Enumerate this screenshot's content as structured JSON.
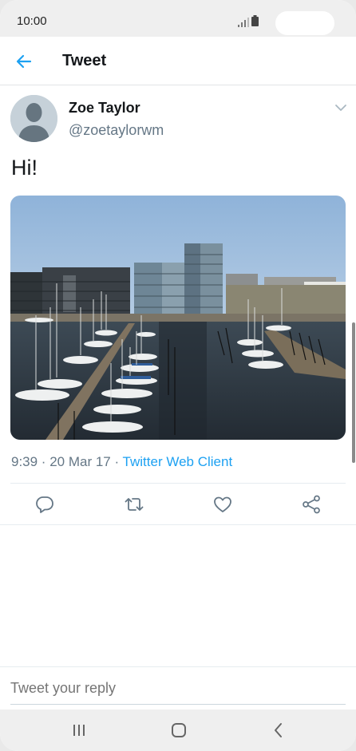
{
  "status_bar": {
    "time": "10:00"
  },
  "app_bar": {
    "title": "Tweet",
    "back_icon": "arrow-left-icon"
  },
  "tweet": {
    "display_name": "Zoe Taylor",
    "handle": "@zoetaylorwm",
    "text": "Hi!",
    "timestamp": "9:39 · 20 Mar 17 · ",
    "source": "Twitter Web Client",
    "photo_icon": "harbor-photo"
  },
  "actions": [
    {
      "name": "reply-icon"
    },
    {
      "name": "retweet-icon"
    },
    {
      "name": "like-icon"
    },
    {
      "name": "share-icon"
    }
  ],
  "reply": {
    "placeholder": "Tweet your reply"
  },
  "colors": {
    "accent": "#1da1f2",
    "muted": "#657786",
    "text": "#14171a"
  }
}
